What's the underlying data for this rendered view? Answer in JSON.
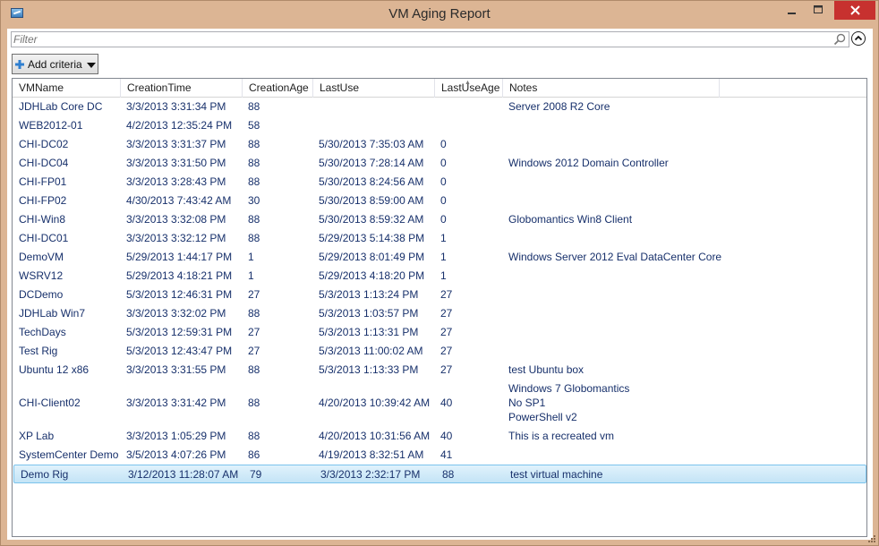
{
  "window": {
    "title": "VM Aging Report"
  },
  "filter": {
    "placeholder": "Filter"
  },
  "criteria": {
    "label": "Add criteria"
  },
  "columns": [
    "VMName",
    "CreationTime",
    "CreationAge",
    "LastUse",
    "LastUseAge",
    "Notes"
  ],
  "rows": [
    [
      "JDHLab Core DC",
      "3/3/2013 3:31:34 PM",
      "88",
      "",
      "",
      "Server 2008 R2 Core"
    ],
    [
      "WEB2012-01",
      "4/2/2013 12:35:24 PM",
      "58",
      "",
      "",
      ""
    ],
    [
      "CHI-DC02",
      "3/3/2013 3:31:37 PM",
      "88",
      "5/30/2013 7:35:03 AM",
      "0",
      ""
    ],
    [
      "CHI-DC04",
      "3/3/2013 3:31:50 PM",
      "88",
      "5/30/2013 7:28:14 AM",
      "0",
      "Windows 2012 Domain Controller"
    ],
    [
      "CHI-FP01",
      "3/3/2013 3:28:43 PM",
      "88",
      "5/30/2013 8:24:56 AM",
      "0",
      ""
    ],
    [
      "CHI-FP02",
      "4/30/2013 7:43:42 AM",
      "30",
      "5/30/2013 8:59:00 AM",
      "0",
      ""
    ],
    [
      "CHI-Win8",
      "3/3/2013 3:32:08 PM",
      "88",
      "5/30/2013 8:59:32 AM",
      "0",
      "Globomantics Win8 Client"
    ],
    [
      "CHI-DC01",
      "3/3/2013 3:32:12 PM",
      "88",
      "5/29/2013 5:14:38 PM",
      "1",
      ""
    ],
    [
      "DemoVM",
      "5/29/2013 1:44:17 PM",
      "1",
      "5/29/2013 8:01:49 PM",
      "1",
      "Windows Server 2012 Eval DataCenter Core"
    ],
    [
      "WSRV12",
      "5/29/2013 4:18:21 PM",
      "1",
      "5/29/2013 4:18:20 PM",
      "1",
      ""
    ],
    [
      "DCDemo",
      "5/3/2013 12:46:31 PM",
      "27",
      "5/3/2013 1:13:24 PM",
      "27",
      ""
    ],
    [
      "JDHLab Win7",
      "3/3/2013 3:32:02 PM",
      "88",
      "5/3/2013 1:03:57 PM",
      "27",
      ""
    ],
    [
      "TechDays",
      "5/3/2013 12:59:31 PM",
      "27",
      "5/3/2013 1:13:31 PM",
      "27",
      ""
    ],
    [
      "Test Rig",
      "5/3/2013 12:43:47 PM",
      "27",
      "5/3/2013 11:00:02 AM",
      "27",
      ""
    ],
    [
      "Ubuntu 12 x86",
      "3/3/2013 3:31:55 PM",
      "88",
      "5/3/2013 1:13:33 PM",
      "27",
      "test Ubuntu box"
    ],
    [
      "CHI-Client02",
      "3/3/2013 3:31:42 PM",
      "88",
      "4/20/2013 10:39:42 AM",
      "40",
      "Windows 7 Globomantics\nNo SP1\nPowerShell v2"
    ],
    [
      "XP Lab",
      "3/3/2013 1:05:29 PM",
      "88",
      "4/20/2013 10:31:56 AM",
      "40",
      "This is a recreated vm"
    ],
    [
      "SystemCenter Demo",
      "3/5/2013 4:07:26 PM",
      "86",
      "4/19/2013 8:32:51 AM",
      "41",
      ""
    ],
    [
      "Demo Rig",
      "3/12/2013 11:28:07 AM",
      "79",
      "3/3/2013 2:32:17 PM",
      "88",
      "test virtual machine"
    ]
  ],
  "selected_row": 18
}
